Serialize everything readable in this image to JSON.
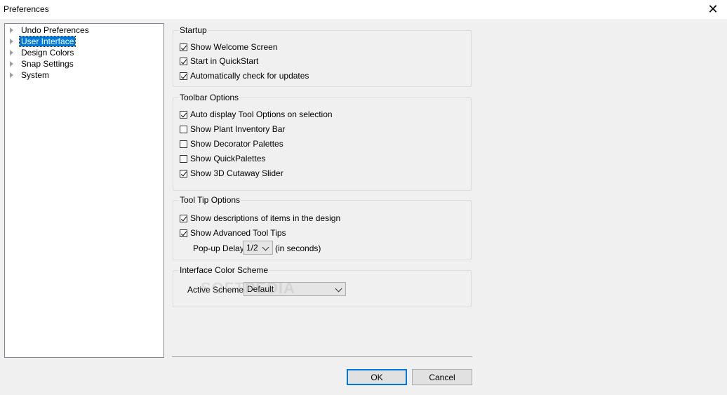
{
  "window": {
    "title": "Preferences",
    "close_label": "✕"
  },
  "tree": {
    "items": [
      {
        "label": "Undo Preferences"
      },
      {
        "label": "User Interface"
      },
      {
        "label": "Design Colors"
      },
      {
        "label": "Snap Settings"
      },
      {
        "label": "System"
      }
    ]
  },
  "startup": {
    "title": "Startup",
    "options": [
      {
        "label": "Show Welcome Screen",
        "checked": true
      },
      {
        "label": "Start in QuickStart",
        "checked": true
      },
      {
        "label": "Automatically check for updates",
        "checked": true
      }
    ]
  },
  "toolbar": {
    "title": "Toolbar Options",
    "options": [
      {
        "label": "Auto display Tool Options on selection",
        "checked": true
      },
      {
        "label": "Show Plant Inventory Bar",
        "checked": false
      },
      {
        "label": "Show Decorator Palettes",
        "checked": false
      },
      {
        "label": "Show QuickPalettes",
        "checked": false
      },
      {
        "label": "Show 3D Cutaway Slider",
        "checked": true
      }
    ]
  },
  "tooltip": {
    "title": "Tool Tip Options",
    "options": [
      {
        "label": "Show descriptions of items in the design",
        "checked": true
      },
      {
        "label": "Show Advanced Tool Tips",
        "checked": true
      }
    ],
    "delay_label": "Pop-up Delay:",
    "delay_value": "1/2",
    "delay_unit": "(in seconds)"
  },
  "color_scheme": {
    "title": "Interface Color Scheme",
    "active_label": "Active Scheme:",
    "active_value": "Default"
  },
  "buttons": {
    "ok": "OK",
    "cancel": "Cancel"
  },
  "watermark": "SOFTPEDIA"
}
